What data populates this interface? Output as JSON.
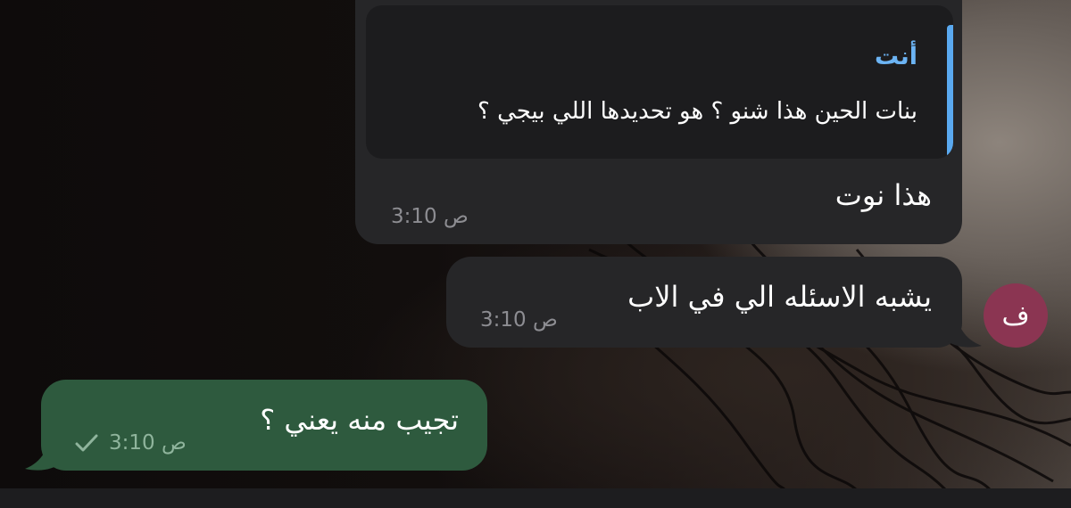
{
  "messages": {
    "reply": {
      "quote_author": "أنت",
      "quote_text": "بنات الحين هذا شنو ؟ هو تحديدها اللي بيجي ؟",
      "text": "هذا نوت",
      "time": "3:10 ص"
    },
    "incoming": {
      "avatar_letter": "ف",
      "avatar_color": "#8b3552",
      "text": "يشبه الاسئله الي في الاب",
      "time": "3:10 ص"
    },
    "outgoing": {
      "text": "تجيب منه يعني ؟",
      "time": "3:10 ص",
      "status_icon": "check-icon"
    }
  },
  "colors": {
    "incoming_bubble": "#262628",
    "outgoing_bubble": "#2e5a3e",
    "quote_accent": "#5aa9f0"
  }
}
